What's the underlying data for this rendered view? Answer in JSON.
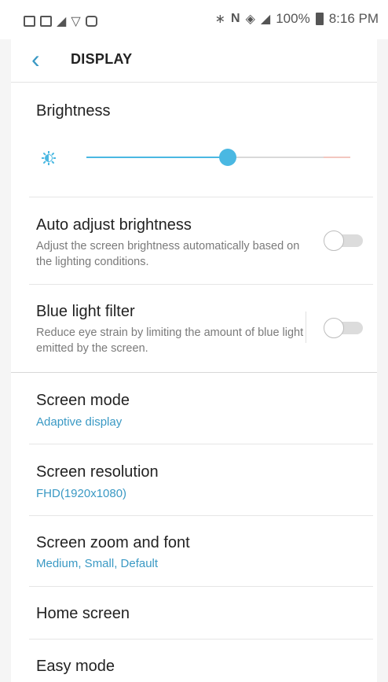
{
  "status_bar": {
    "battery_text": "100%",
    "time": "8:16 PM"
  },
  "header": {
    "title": "DISPLAY"
  },
  "brightness": {
    "label": "Brightness",
    "level_fraction": 0.54
  },
  "auto_adjust": {
    "label": "Auto adjust brightness",
    "description": "Adjust the screen brightness automatically based on the lighting conditions.",
    "enabled": false
  },
  "blue_light": {
    "label": "Blue light filter",
    "description": "Reduce eye strain by limiting the amount of blue light emitted by the screen.",
    "enabled": false
  },
  "screen_mode": {
    "label": "Screen mode",
    "value": "Adaptive display"
  },
  "screen_resolution": {
    "label": "Screen resolution",
    "value": "FHD(1920x1080)"
  },
  "screen_zoom": {
    "label": "Screen zoom and font",
    "value": "Medium, Small, Default"
  },
  "home_screen": {
    "label": "Home screen"
  },
  "easy_mode": {
    "label": "Easy mode"
  },
  "colors": {
    "accent": "#3a99c4",
    "slider": "#4ab8e2"
  }
}
